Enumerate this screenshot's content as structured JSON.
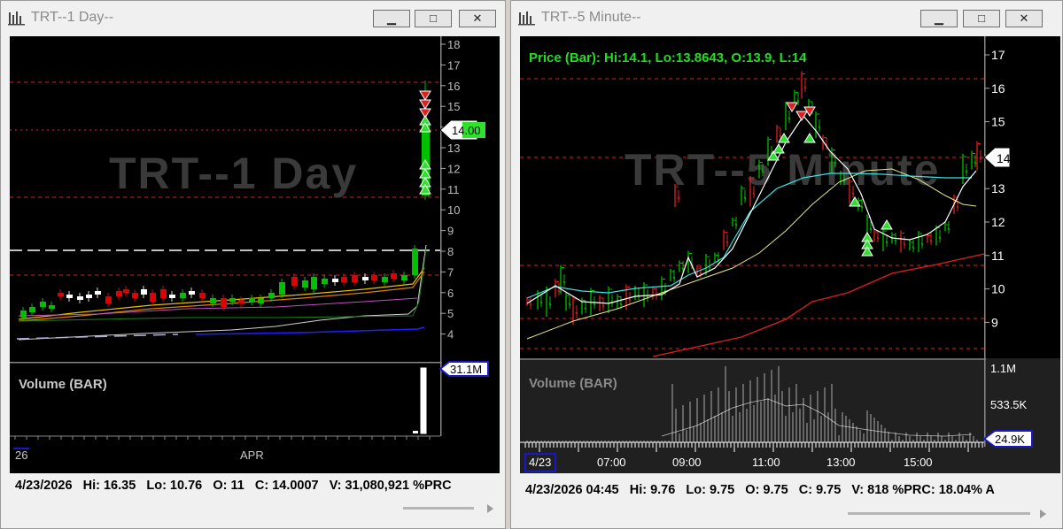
{
  "left_window": {
    "title": "TRT--1 Day--",
    "watermark": "TRT--1 Day",
    "price_axis_labels": [
      "18",
      "17",
      "16",
      "15",
      "14",
      "13",
      "12",
      "11",
      "10",
      "9",
      "8",
      "7",
      "6",
      "5",
      "4"
    ],
    "last_price_tag": "14.00",
    "volume_label": "Volume (BAR)",
    "volume_tag": "31.1M",
    "time_labels": [
      "26",
      "APR"
    ],
    "info": {
      "date": "4/23/2026",
      "hi": "Hi: 16.35",
      "lo": "Lo: 10.76",
      "o": "O: 11",
      "c": "C: 14.0007",
      "v": "V: 31,080,921",
      "prc": "%PRC"
    }
  },
  "right_window": {
    "title": "TRT--5 Minute--",
    "watermark": "TRT--5 Minute",
    "price_header": "Price (Bar): Hi:14.1, Lo:13.8643, O:13.9, L:14",
    "price_axis_labels": [
      "17",
      "16",
      "15",
      "14",
      "13",
      "12",
      "11",
      "10",
      "9"
    ],
    "last_price_tag": "14",
    "volume_label": "Volume (BAR)",
    "volume_axis_labels": [
      "1.1M",
      "533.5K"
    ],
    "volume_tag": "24.9K",
    "time_labels": [
      "4/23",
      "07:00",
      "09:00",
      "11:00",
      "13:00",
      "15:00"
    ],
    "info": {
      "date": "4/23/2026 04:45",
      "hi": "Hi: 9.76",
      "lo": "Lo: 9.75",
      "o": "O: 9.75",
      "c": "C: 9.75",
      "v": "V: 818",
      "prc": "%PRC: 18.04%",
      "extra": "A"
    }
  },
  "window_buttons": {
    "minimize": "▁",
    "maximize": "□",
    "close": "✕"
  },
  "colors": {
    "up": "#00c000",
    "down": "#e00000",
    "ref_line": "#e02020",
    "header_green": "#22dd22",
    "ma_cyan": "#40e0e0",
    "ma_yellow": "#e8e890",
    "ma_red": "#dd2020",
    "ma_blue": "#2020ff",
    "tag_blue": "#1818c8"
  }
}
